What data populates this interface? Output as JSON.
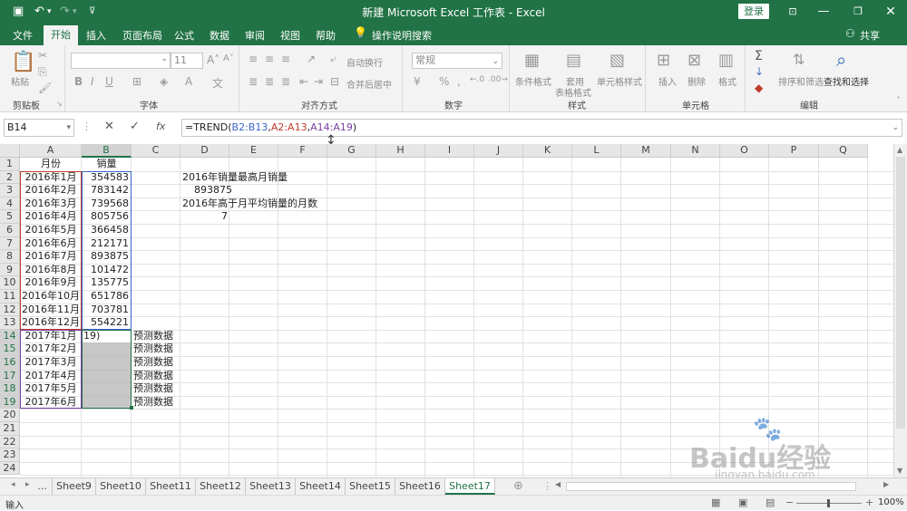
{
  "window": {
    "title": "新建 Microsoft Excel 工作表 - Excel",
    "login_label": "登录",
    "share_label": "共享"
  },
  "tabs": [
    "文件",
    "开始",
    "插入",
    "页面布局",
    "公式",
    "数据",
    "审阅",
    "视图",
    "帮助"
  ],
  "active_tab": "开始",
  "tell_me": "操作说明搜索",
  "ribbon": {
    "clipboard": {
      "paste": "粘贴",
      "label": "剪贴板"
    },
    "font": {
      "size": "11",
      "label": "字体",
      "bold": "B",
      "italic": "I",
      "underline": "U"
    },
    "align": {
      "wrap": "自动换行",
      "merge": "合并后居中",
      "label": "对齐方式"
    },
    "number": {
      "format": "常规",
      "label": "数字"
    },
    "styles": {
      "cond": "条件格式",
      "table_line1": "套用",
      "table_line2": "表格格式",
      "cell": "单元格样式",
      "label": "样式"
    },
    "cells": {
      "insert": "插入",
      "delete": "删除",
      "format": "格式",
      "label": "单元格"
    },
    "editing": {
      "sort": "排序和筛选",
      "find": "查找和选择",
      "label": "编辑"
    }
  },
  "formula_bar": {
    "name_box": "B14",
    "parts": [
      {
        "text": "=TREND(",
        "color": "#222222"
      },
      {
        "text": "B2:B13",
        "color": "#3a63c8"
      },
      {
        "text": ",",
        "color": "#222222"
      },
      {
        "text": "A2:A13",
        "color": "#c0392b"
      },
      {
        "text": ",",
        "color": "#222222"
      },
      {
        "text": "A14:A19",
        "color": "#7a3fa5"
      },
      {
        "text": ")",
        "color": "#222222"
      }
    ]
  },
  "columns": [
    "A",
    "B",
    "C",
    "D",
    "E",
    "F",
    "G",
    "H",
    "I",
    "J",
    "K",
    "L",
    "M",
    "N",
    "O",
    "P",
    "Q"
  ],
  "rows": [
    "1",
    "2",
    "3",
    "4",
    "5",
    "6",
    "7",
    "8",
    "9",
    "10",
    "11",
    "12",
    "13",
    "14",
    "15",
    "16",
    "17",
    "18",
    "19",
    "20",
    "21",
    "22",
    "23",
    "24"
  ],
  "col_a": [
    "月份",
    "2016年1月",
    "2016年2月",
    "2016年3月",
    "2016年4月",
    "2016年5月",
    "2016年6月",
    "2016年7月",
    "2016年8月",
    "2016年9月",
    "2016年10月",
    "2016年11月",
    "2016年12月",
    "2017年1月",
    "2017年2月",
    "2017年3月",
    "2017年4月",
    "2017年5月",
    "2017年6月"
  ],
  "col_b": [
    "销量",
    "354583",
    "783142",
    "739568",
    "805756",
    "366458",
    "212171",
    "893875",
    "101472",
    "135775",
    "651786",
    "703781",
    "554221",
    "19)",
    "",
    "",
    "",
    "",
    ""
  ],
  "col_c": [
    "",
    "",
    "",
    "",
    "",
    "",
    "",
    "",
    "",
    "",
    "",
    "",
    "",
    "预测数据",
    "预测数据",
    "预测数据",
    "预测数据",
    "预测数据",
    "预测数据"
  ],
  "col_d": [
    "",
    "2016年销量最高月销量",
    "893875",
    "2016年高于月平均销量的月数",
    "7"
  ],
  "sheets": [
    "...",
    "Sheet9",
    "Sheet10",
    "Sheet11",
    "Sheet12",
    "Sheet13",
    "Sheet14",
    "Sheet15",
    "Sheet16",
    "Sheet17"
  ],
  "active_sheet": "Sheet17",
  "status": {
    "mode": "输入",
    "zoom": "100%"
  },
  "watermark": {
    "brand": "Baidu经验",
    "url": "jingyan.baidu.com"
  }
}
